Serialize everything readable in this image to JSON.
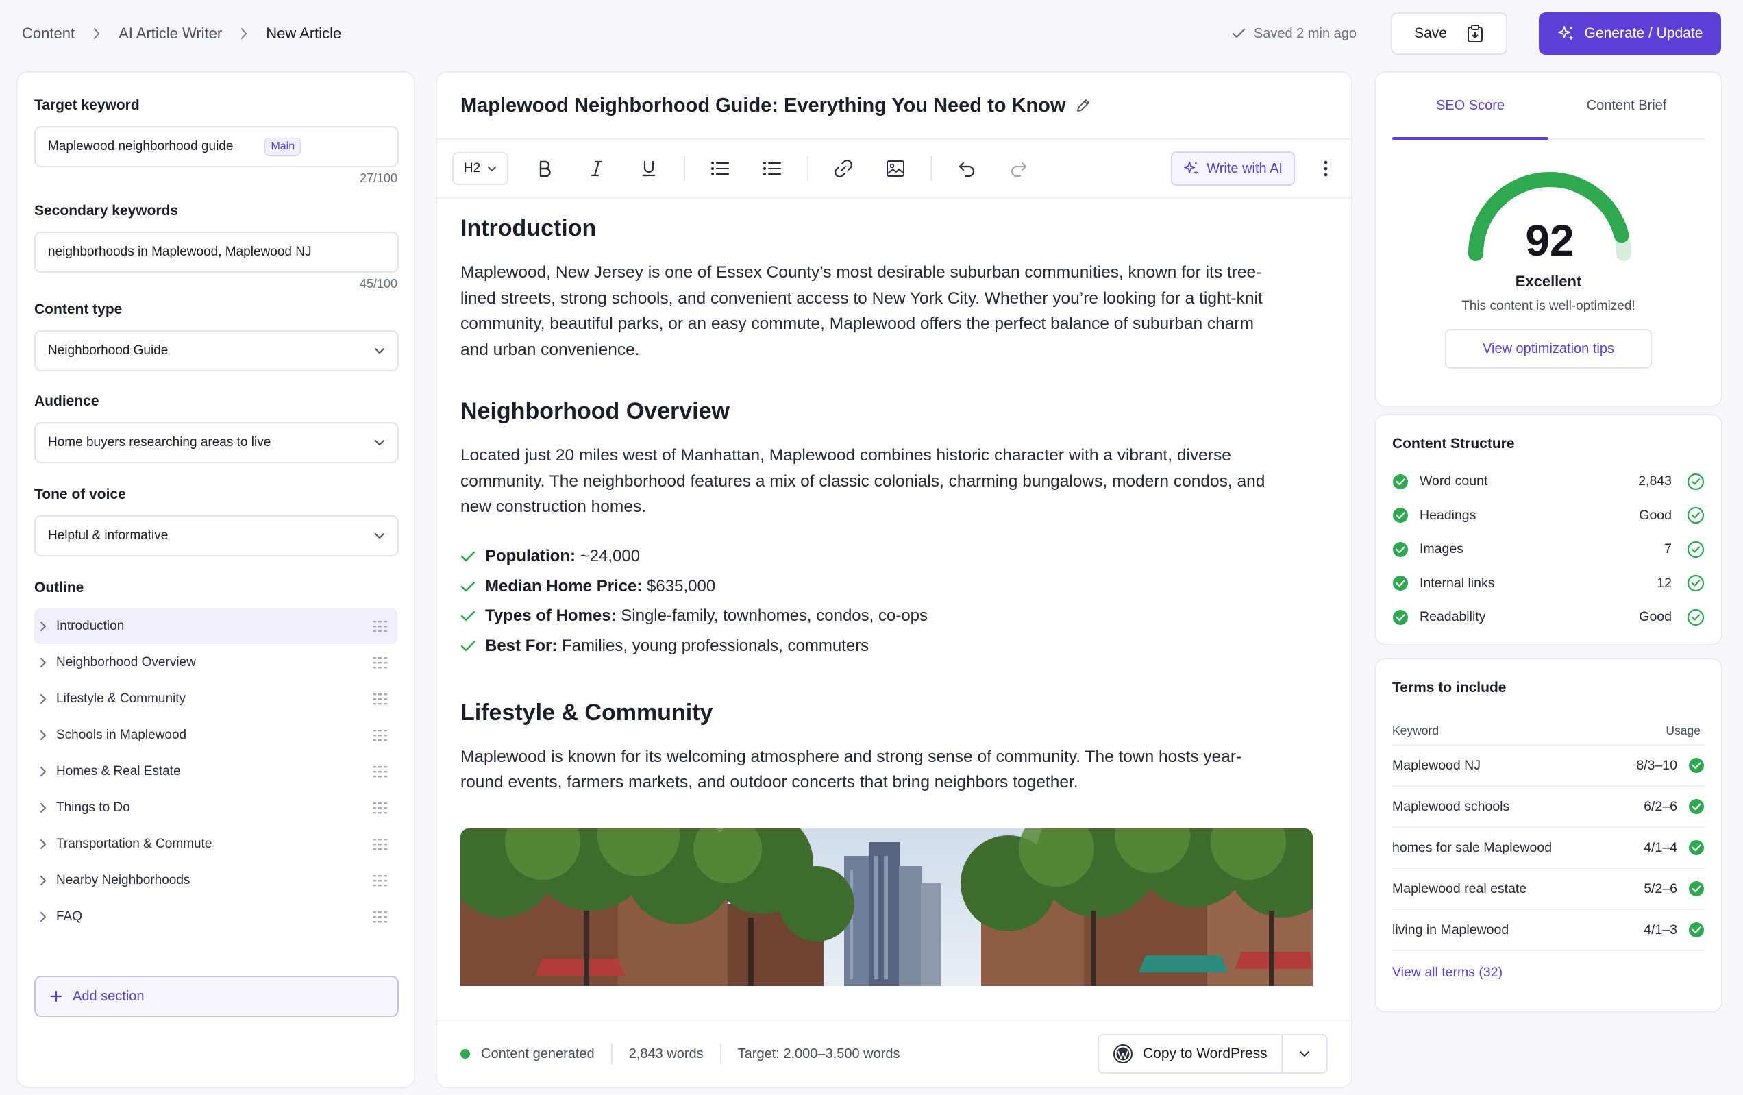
{
  "breadcrumb": {
    "items": [
      "Content",
      "AI Article Writer",
      "New Article"
    ]
  },
  "header": {
    "saved_text": "Saved 2 min ago",
    "save_label": "Save",
    "generate_label": "Generate / Update",
    "accent_color": "#5b3fd6"
  },
  "left": {
    "target_keyword": {
      "label": "Target keyword",
      "value": "Maplewood neighborhood guide",
      "badge": "Main",
      "counter": "27/100"
    },
    "secondary_keywords": {
      "label": "Secondary keywords",
      "value": "neighborhoods in Maplewood, Maplewood NJ",
      "counter": "45/100"
    },
    "content_type": {
      "label": "Content type",
      "value": "Neighborhood Guide"
    },
    "audience": {
      "label": "Audience",
      "value": "Home buyers researching areas to live"
    },
    "tone": {
      "label": "Tone of voice",
      "value": "Helpful & informative"
    },
    "outline": {
      "label": "Outline",
      "items": [
        "Introduction",
        "Neighborhood Overview",
        "Lifestyle & Community",
        "Schools in Maplewood",
        "Homes & Real Estate",
        "Things to Do",
        "Transportation & Commute",
        "Nearby Neighborhoods",
        "FAQ"
      ]
    },
    "add_section_label": "Add section"
  },
  "editor": {
    "title": "Maplewood Neighborhood Guide: Everything You Need to Know",
    "heading_level": "H2",
    "write_ai_label": "Write with AI",
    "sections": {
      "intro_h": "Introduction",
      "intro_p": "Maplewood, New Jersey is one of Essex County’s most desirable suburban communities, known for its tree-lined streets, strong schools, and convenient access to New York City. Whether you’re looking for a tight-knit community, beautiful parks, or an easy commute, Maplewood offers the perfect balance of suburban charm and urban convenience.",
      "overview_h": "Neighborhood Overview",
      "overview_p": "Located just 20 miles west of Manhattan, Maplewood combines historic character with a vibrant, diverse community. The neighborhood features a mix of classic colonials, charming bungalows, modern condos, and new construction homes.",
      "facts": [
        {
          "k": "Population:",
          "v": " ~24,000"
        },
        {
          "k": "Median Home Price:",
          "v": " $635,000"
        },
        {
          "k": "Types of Homes:",
          "v": " Single-family, townhomes, condos, co-ops"
        },
        {
          "k": "Best For:",
          "v": " Families, young professionals, commuters"
        }
      ],
      "lifestyle_h": "Lifestyle & Community",
      "lifestyle_p": "Maplewood is known for its welcoming atmosphere and strong sense of community. The town hosts year-round events, farmers markets, and outdoor concerts that bring neighbors together."
    },
    "footer": {
      "status": "Content generated",
      "words": "2,843 words",
      "target": "Target: 2,000–3,500 words",
      "copy_label": "Copy to WordPress"
    }
  },
  "seo": {
    "tabs": [
      "SEO Score",
      "Content Brief"
    ],
    "score": "92",
    "score_value": 92,
    "rating": "Excellent",
    "subtitle": "This content is well-optimized!",
    "tips_label": "View optimization tips"
  },
  "structure": {
    "title": "Content Structure",
    "rows": [
      {
        "label": "Word count",
        "value": "2,843"
      },
      {
        "label": "Headings",
        "value": "Good"
      },
      {
        "label": "Images",
        "value": "7"
      },
      {
        "label": "Internal links",
        "value": "12"
      },
      {
        "label": "Readability",
        "value": "Good"
      }
    ]
  },
  "terms": {
    "title": "Terms to include",
    "col_keyword": "Keyword",
    "col_usage": "Usage",
    "rows": [
      {
        "term": "Maplewood NJ",
        "usage": "8/3–10"
      },
      {
        "term": "Maplewood schools",
        "usage": "6/2–6"
      },
      {
        "term": "homes for sale Maplewood",
        "usage": "4/1–4"
      },
      {
        "term": "Maplewood real estate",
        "usage": "5/2–6"
      },
      {
        "term": "living in Maplewood",
        "usage": "4/1–3"
      }
    ],
    "view_all": "View all terms (32)"
  }
}
